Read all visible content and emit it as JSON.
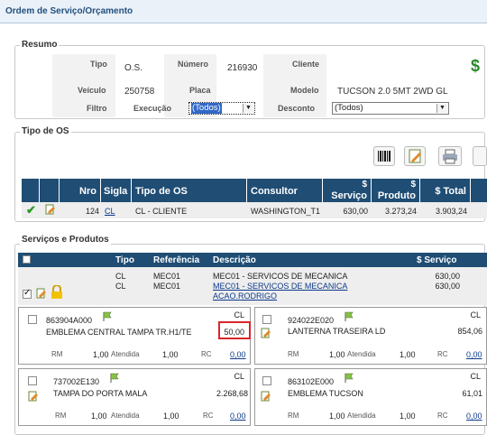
{
  "window": {
    "title": "Ordem de Serviço/Orçamento"
  },
  "resumo": {
    "legend": "Resumo",
    "tipo_label": "Tipo",
    "tipo_value": "O.S.",
    "numero_label": "Número",
    "numero_value": "216930",
    "cliente_label": "Cliente",
    "veiculo_label": "Veículo",
    "veiculo_value": "250758",
    "placa_label": "Placa",
    "modelo_label": "Modelo",
    "modelo_value": "TUCSON 2.0 5MT 2WD GL",
    "filtro_label": "Filtro",
    "execucao_label": "Execução",
    "execucao_value": "(Todos)",
    "desconto_label": "Desconto",
    "desconto_value": "(Todos)",
    "dollar_icon": "$"
  },
  "tipo_os": {
    "legend": "Tipo de OS",
    "headers": {
      "nro": "Nro",
      "sigla": "Sigla",
      "tipo": "Tipo de OS",
      "consultor": "Consultor",
      "servico_sym": "$",
      "servico": "Serviço",
      "produto_sym": "$",
      "produto": "Produto",
      "total": "$ Total"
    },
    "row": {
      "nro": "124",
      "sigla": "CL",
      "tipo": "CL - CLIENTE",
      "consultor": "WASHINGTON_T1",
      "servico": "630,00",
      "produto": "3.273,24",
      "total": "3.903,24"
    }
  },
  "servicos": {
    "legend": "Serviços e Produtos",
    "headers": {
      "tipo": "Tipo",
      "referencia": "Referência",
      "descricao": "Descrição",
      "servico": "$ Serviço"
    },
    "rows": [
      {
        "tipo": "CL",
        "ref": "MEC01",
        "desc": "MEC01 - SERVICOS DE MECANICA",
        "valor": "630,00"
      },
      {
        "tipo": "CL",
        "ref": "MEC01",
        "desc": "MEC01 - SERVICOS DE MECANICA",
        "desc2": "ACAO.RODRIGO",
        "valor": "630,00"
      }
    ],
    "cards": [
      {
        "code": "863904A000",
        "badge": "CL",
        "desc": "EMBLEMA CENTRAL TAMPA TR.H1/TE",
        "valor": "50,00",
        "rm": "RM",
        "qtd": "1,00",
        "atendida": "Atendida",
        "qtd2": "1,00",
        "rc": "RC",
        "link": "0,00"
      },
      {
        "code": "924022E020",
        "badge": "CL",
        "desc": "LANTERNA TRASEIRA LD",
        "valor": "854,06",
        "rm": "RM",
        "qtd": "1,00",
        "atendida": "Atendida",
        "qtd2": "1,00",
        "rc": "RC",
        "link": "0,00"
      },
      {
        "code": "737002E130",
        "badge": "CL",
        "desc": "TAMPA DO PORTA MALA",
        "valor": "2.268,68",
        "rm": "RM",
        "qtd": "1,00",
        "atendida": "Atendida",
        "qtd2": "1,00",
        "rc": "RC",
        "link": "0,00"
      },
      {
        "code": "863102E000",
        "badge": "CL",
        "desc": "EMBLEMA TUCSON",
        "valor": "61,01",
        "rm": "RM",
        "qtd": "1,00",
        "atendida": "Atendida",
        "qtd2": "1,00",
        "rc": "RC",
        "link": "0,00"
      }
    ]
  },
  "colors": {
    "header_blue": "#1f4d74",
    "highlight_red": "#d8262a",
    "title_blue": "#21507e"
  }
}
